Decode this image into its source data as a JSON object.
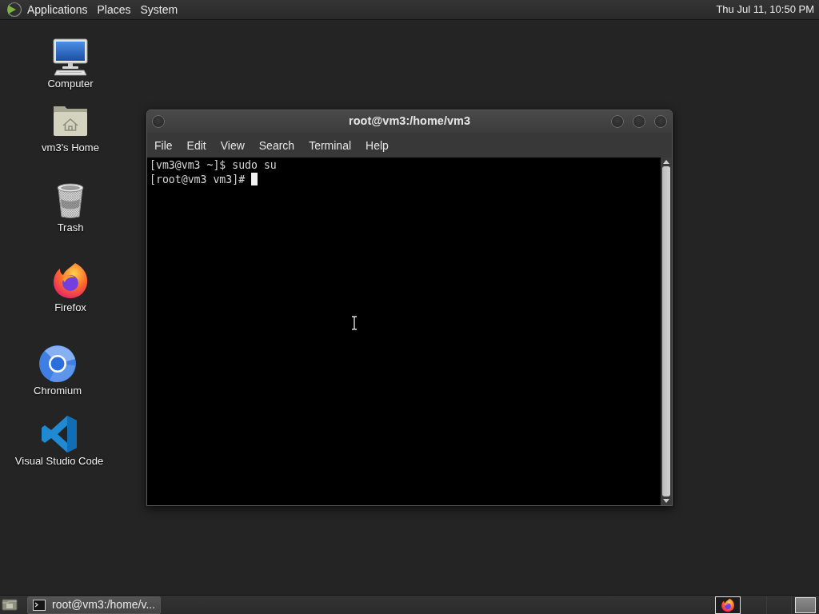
{
  "top_panel": {
    "menus": [
      "Applications",
      "Places",
      "System"
    ],
    "clock": "Thu Jul 11, 10:50 PM"
  },
  "desktop_icons": [
    {
      "kind": "computer",
      "label": "Computer"
    },
    {
      "kind": "home",
      "label": "vm3's Home"
    },
    {
      "kind": "trash",
      "label": "Trash"
    },
    {
      "kind": "firefox",
      "label": "Firefox"
    },
    {
      "kind": "chromium",
      "label": "Chromium"
    },
    {
      "kind": "vscode",
      "label": "Visual Studio Code"
    }
  ],
  "terminal_window": {
    "title": "root@vm3:/home/vm3",
    "menus": [
      "File",
      "Edit",
      "View",
      "Search",
      "Terminal",
      "Help"
    ],
    "lines": [
      "[vm3@vm3 ~]$ sudo su",
      "[root@vm3 vm3]#"
    ]
  },
  "bottom_panel": {
    "tasks": [
      {
        "label": "root@vm3:/home/v...",
        "selected": true
      }
    ]
  }
}
